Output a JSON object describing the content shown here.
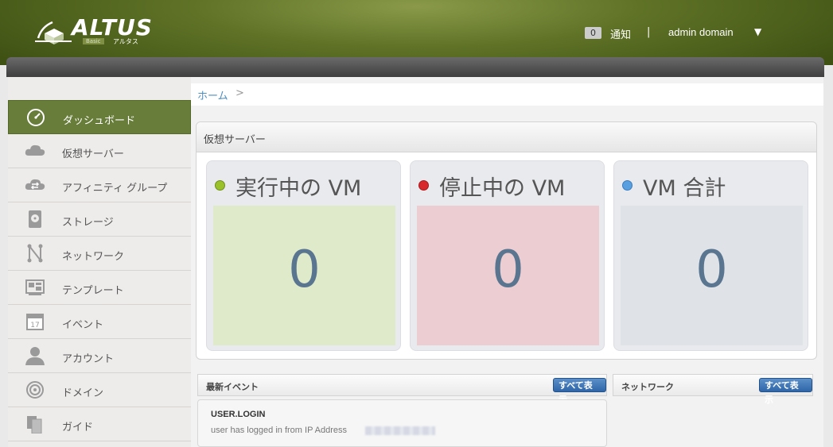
{
  "header": {
    "logo_text": "ALTUS",
    "logo_edition": "Basic",
    "logo_kana": "アルタス",
    "notification_count": "0",
    "notification_label": "通知",
    "separator": "|",
    "user_name": "admin domain",
    "user_caret": "▼"
  },
  "sidebar": {
    "items": [
      {
        "label": "ダッシュボード",
        "icon": "dashboard-icon",
        "active": true
      },
      {
        "label": "仮想サーバー",
        "icon": "cloud-icon"
      },
      {
        "label": "アフィニティ グループ",
        "icon": "cloud-sync-icon"
      },
      {
        "label": "ストレージ",
        "icon": "storage-disk-icon"
      },
      {
        "label": "ネットワーク",
        "icon": "network-icon"
      },
      {
        "label": "テンプレート",
        "icon": "template-icon"
      },
      {
        "label": "イベント",
        "icon": "calendar-icon"
      },
      {
        "label": "アカウント",
        "icon": "user-icon"
      },
      {
        "label": "ドメイン",
        "icon": "domain-target-icon"
      },
      {
        "label": "ガイド",
        "icon": "guide-icon"
      }
    ]
  },
  "breadcrumb": {
    "home": "ホーム",
    "separator": ">"
  },
  "vm_panel": {
    "title": "仮想サーバー",
    "cards": [
      {
        "title": "実行中の VM",
        "count": "0",
        "dot_color": "#9ac12a",
        "box_color": "#dfeacb"
      },
      {
        "title": "停止中の VM",
        "count": "0",
        "dot_color": "#d9282c",
        "box_color": "#eccdd2"
      },
      {
        "title": "VM 合計",
        "count": "0",
        "dot_color": "#5aa0e0",
        "box_color": "#dfe3e8"
      }
    ]
  },
  "events_panel": {
    "title": "最新イベント",
    "view_all": "すべて表示",
    "items": [
      {
        "type": "USER.LOGIN",
        "description": "user has logged in from IP Address"
      }
    ]
  },
  "network_panel": {
    "title": "ネットワーク",
    "view_all": "すべて表示"
  }
}
